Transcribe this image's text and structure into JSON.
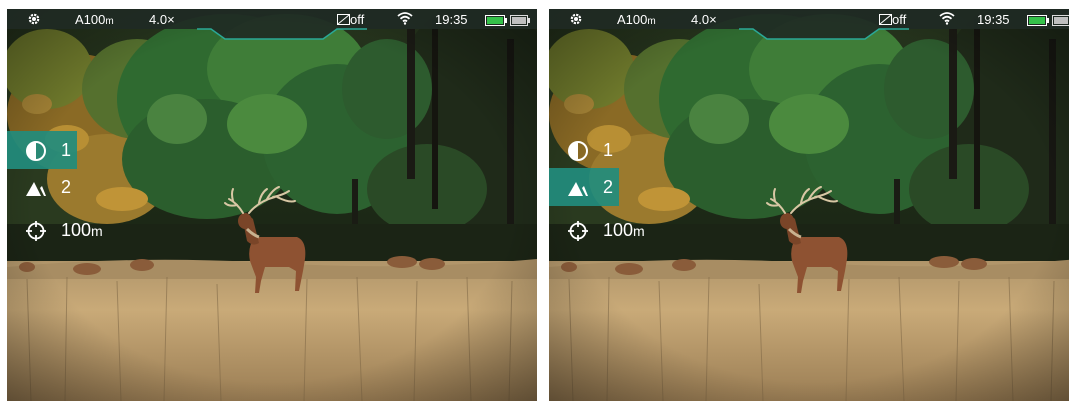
{
  "screens": [
    {
      "status": {
        "settings_icon": "gear-icon",
        "mode": "A100",
        "mode_unit": "m",
        "zoom": "4.0×",
        "recording_status": "off",
        "time": "19:35",
        "battery_icon": "battery-icon",
        "battery_level": 1.0,
        "ext_battery_icon": "external-battery-icon"
      },
      "menu": {
        "items": [
          {
            "icon": "contrast-icon",
            "value": "1",
            "unit": "",
            "active": true
          },
          {
            "icon": "mountain-icon",
            "value": "2",
            "unit": "",
            "active": false
          },
          {
            "icon": "crosshair-icon",
            "value": "100",
            "unit": "m",
            "active": false
          }
        ]
      }
    },
    {
      "status": {
        "settings_icon": "gear-icon",
        "mode": "A100",
        "mode_unit": "m",
        "zoom": "4.0×",
        "recording_status": "off",
        "time": "19:35",
        "battery_icon": "battery-icon",
        "battery_level": 1.0,
        "ext_battery_icon": "external-battery-icon"
      },
      "menu": {
        "items": [
          {
            "icon": "contrast-icon",
            "value": "1",
            "unit": "",
            "active": false
          },
          {
            "icon": "mountain-icon",
            "value": "2",
            "unit": "",
            "active": true
          },
          {
            "icon": "crosshair-icon",
            "value": "100",
            "unit": "m",
            "active": false
          }
        ]
      }
    }
  ],
  "colors": {
    "accent": "#1f8c7f",
    "battery": "#35c24a",
    "text": "#ffffff"
  }
}
